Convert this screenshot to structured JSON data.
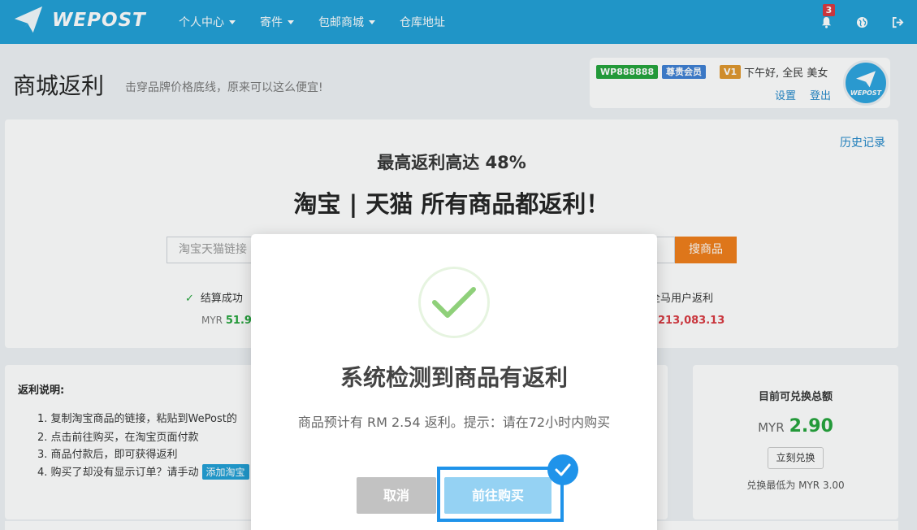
{
  "brand": {
    "name": "WEPOST",
    "avatar_text": "WEPOST"
  },
  "nav": {
    "items": [
      {
        "label": "个人中心",
        "has_caret": true
      },
      {
        "label": "寄件",
        "has_caret": true
      },
      {
        "label": "包邮商城",
        "has_caret": true
      },
      {
        "label": "仓库地址",
        "has_caret": false
      }
    ],
    "notification_count": "3",
    "icons": [
      "bell-icon",
      "globe-icon",
      "logout-icon"
    ]
  },
  "page": {
    "title": "商城返利",
    "subtitle": "击穿品牌价格底线，原来可以这么便宜!"
  },
  "user": {
    "id_tag": "WP888888",
    "member_tag": "尊贵会员",
    "level_tag": "V1",
    "greeting": "下午好, 全民 美女",
    "settings_label": "设置",
    "logout_label": "登出"
  },
  "main": {
    "history_label": "历史记录",
    "headline_small": "最高返利高达 48%",
    "headline_big": "淘宝 | 天猫 所有商品都返利！",
    "search": {
      "placeholder": "淘宝天猫链接",
      "button_label": "搜商品"
    },
    "stats": {
      "left_label": "结算成功",
      "left_currency": "MYR",
      "left_value": "51.9",
      "right_label": "全马用户返利",
      "right_value": "213,083.13"
    }
  },
  "info": {
    "title": "返利说明:",
    "steps": [
      "1. 复制淘宝商品的链接，粘贴到WePost的",
      "2. 点击前往购买，在淘宝页面付款",
      "3. 商品付款后，即可获得返利",
      "4. 购买了却没有显示订单？请手动"
    ],
    "add_order_label": "添加淘宝"
  },
  "redeem": {
    "title": "目前可兑换总额",
    "currency": "MYR",
    "amount": "2.90",
    "button_label": "立刻兑换",
    "min_text": "兑换最低为 MYR 3.00"
  },
  "modal": {
    "title": "系统检测到商品有返利",
    "message": "商品预计有 RM 2.54 返利。提示：请在72小时内购买",
    "cancel_label": "取消",
    "confirm_label": "前往购买"
  },
  "colors": {
    "brand_blue": "#1f9fd6",
    "success_green": "#23a33a",
    "danger_red": "#d9363e",
    "orange": "#f07d18",
    "highlight_blue": "#1f93ea"
  }
}
